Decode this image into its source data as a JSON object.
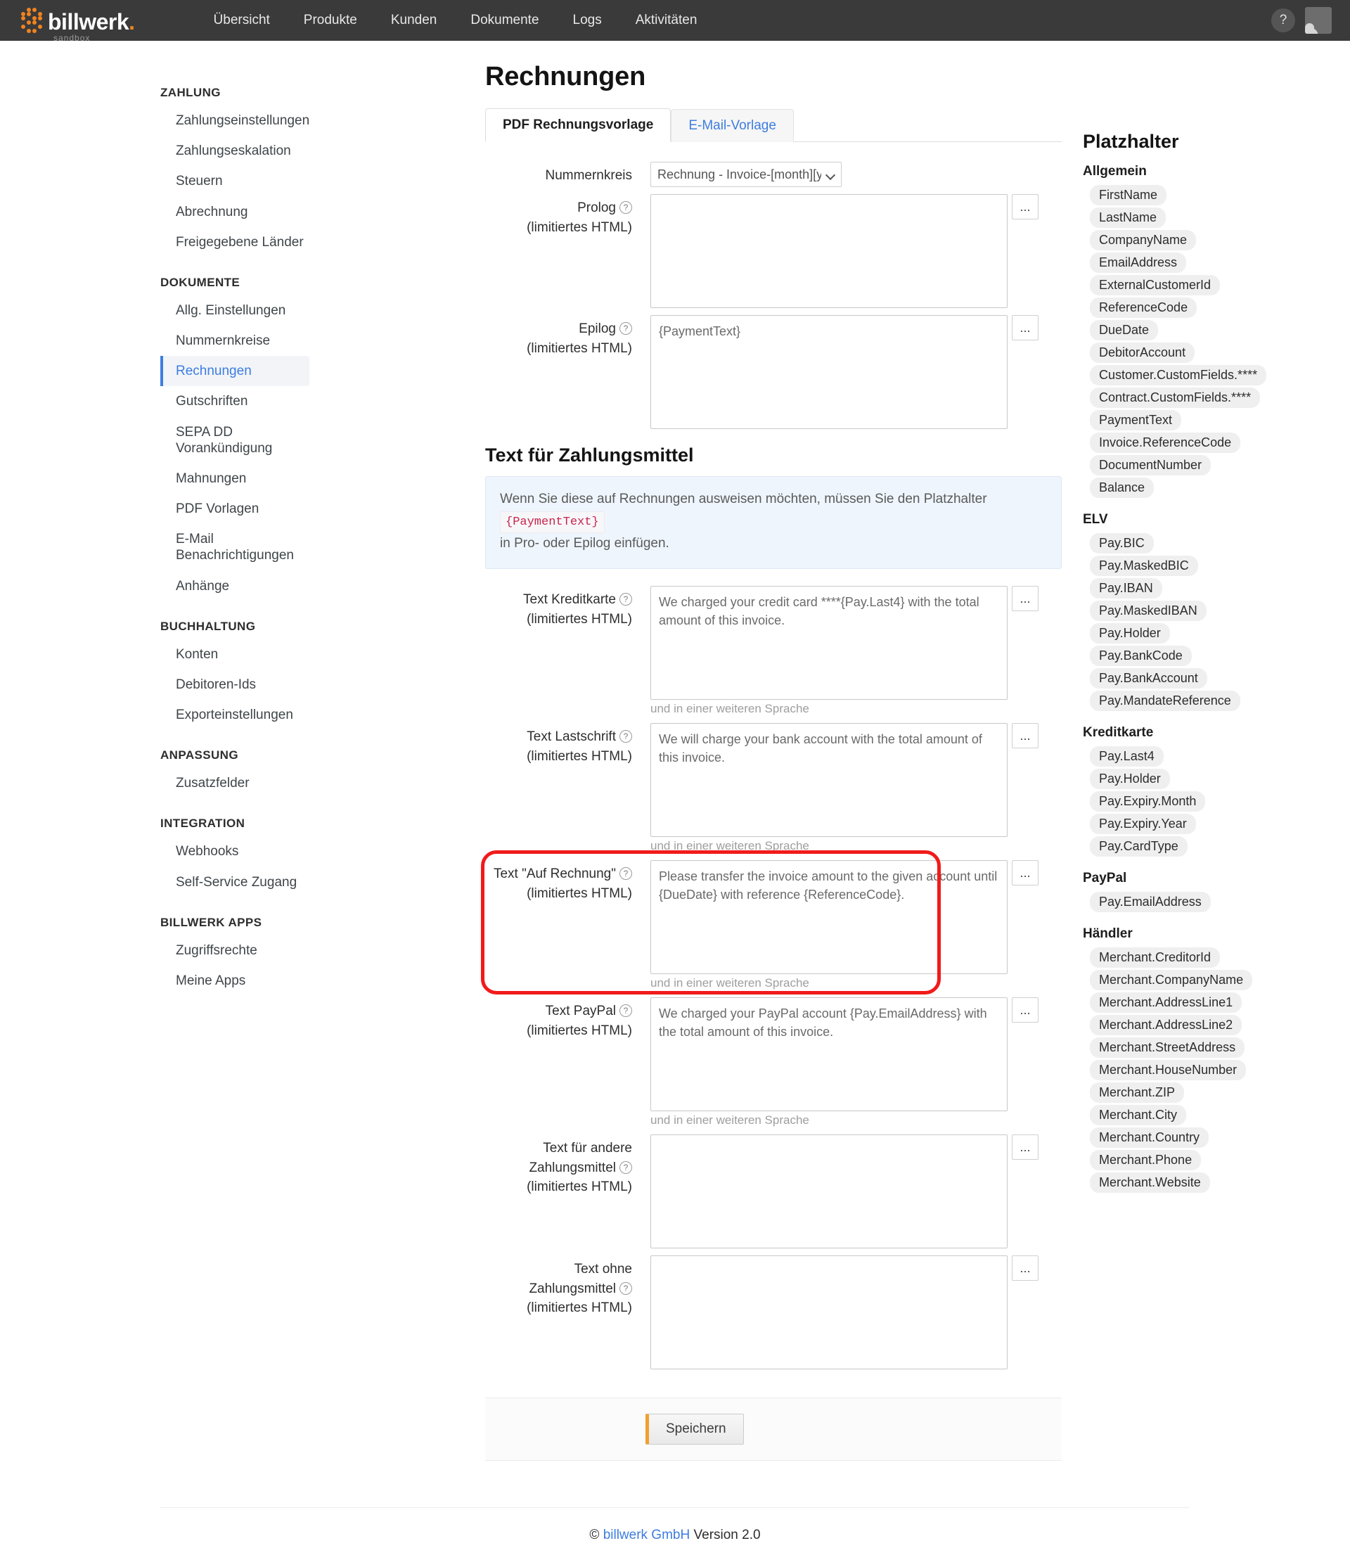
{
  "topnav": {
    "brand": {
      "name": "billwerk",
      "dot": ".",
      "sub": "sandbox"
    },
    "links": [
      "Übersicht",
      "Produkte",
      "Kunden",
      "Dokumente",
      "Logs",
      "Aktivitäten"
    ],
    "help_label": "?"
  },
  "sidebar": {
    "groups": [
      {
        "title": "ZAHLUNG",
        "items": [
          {
            "label": "Zahlungseinstellungen",
            "active": false
          },
          {
            "label": "Zahlungseskalation",
            "active": false
          },
          {
            "label": "Steuern",
            "active": false
          },
          {
            "label": "Abrechnung",
            "active": false
          },
          {
            "label": "Freigegebene Länder",
            "active": false
          }
        ]
      },
      {
        "title": "DOKUMENTE",
        "items": [
          {
            "label": "Allg. Einstellungen",
            "active": false
          },
          {
            "label": "Nummernkreise",
            "active": false
          },
          {
            "label": "Rechnungen",
            "active": true
          },
          {
            "label": "Gutschriften",
            "active": false
          },
          {
            "label": "SEPA DD Vorankündigung",
            "active": false
          },
          {
            "label": "Mahnungen",
            "active": false
          },
          {
            "label": "PDF Vorlagen",
            "active": false
          },
          {
            "label": "E-Mail Benachrichtigungen",
            "active": false
          },
          {
            "label": "Anhänge",
            "active": false
          }
        ]
      },
      {
        "title": "BUCHHALTUNG",
        "items": [
          {
            "label": "Konten",
            "active": false
          },
          {
            "label": "Debitoren-Ids",
            "active": false
          },
          {
            "label": "Exporteinstellungen",
            "active": false
          }
        ]
      },
      {
        "title": "ANPASSUNG",
        "items": [
          {
            "label": "Zusatzfelder",
            "active": false
          }
        ]
      },
      {
        "title": "INTEGRATION",
        "items": [
          {
            "label": "Webhooks",
            "active": false
          },
          {
            "label": "Self-Service Zugang",
            "active": false
          }
        ]
      },
      {
        "title": "BILLWERK APPS",
        "items": [
          {
            "label": "Zugriffsrechte",
            "active": false
          },
          {
            "label": "Meine Apps",
            "active": false
          }
        ]
      }
    ]
  },
  "main": {
    "page_title": "Rechnungen",
    "tabs": [
      {
        "label": "PDF Rechnungsvorlage",
        "active": true
      },
      {
        "label": "E-Mail-Vorlage",
        "active": false
      }
    ],
    "nummernkreis": {
      "label": "Nummernkreis",
      "value": "Rechnung - Invoice-[month][year]-",
      "options": [
        "Rechnung - Invoice-[month][year]-"
      ]
    },
    "limited_html_note": "(limitiertes HTML)",
    "more_button_label": "...",
    "lang_hint": "und in einer weiteren Sprache",
    "fields_top": [
      {
        "label": "Prolog",
        "value": "",
        "hint": false
      },
      {
        "label": "Epilog",
        "value": "{PaymentText}",
        "hint": false
      }
    ],
    "section": {
      "title": "Text für Zahlungsmittel",
      "notice_before": "Wenn Sie diese auf Rechnungen ausweisen möchten, müssen Sie den Platzhalter",
      "notice_code": "{PaymentText}",
      "notice_after": "in Pro- oder Epilog einfügen."
    },
    "payment_fields": [
      {
        "label": "Text Kreditkarte",
        "value": "We charged your credit card ****{Pay.Last4} with the total amount of this invoice.",
        "hint": true,
        "highlighted": false
      },
      {
        "label": "Text Lastschrift",
        "value": "We will charge your bank account with the total amount of this invoice.",
        "hint": true,
        "highlighted": false
      },
      {
        "label": "Text \"Auf Rechnung\"",
        "value": "Please transfer the invoice amount to the given account until {DueDate} with reference {ReferenceCode}.",
        "hint": true,
        "highlighted": true
      },
      {
        "label": "Text PayPal",
        "value": "We charged your PayPal account {Pay.EmailAddress} with the total amount of this invoice.",
        "hint": true,
        "highlighted": false
      },
      {
        "label": "Text für andere Zahlungsmittel",
        "value": "",
        "hint": false,
        "highlighted": false
      },
      {
        "label": "Text ohne Zahlungsmittel",
        "value": "",
        "hint": false,
        "highlighted": false
      }
    ],
    "save_label": "Speichern"
  },
  "placeholders": {
    "title": "Platzhalter",
    "groups": [
      {
        "title": "Allgemein",
        "items": [
          "FirstName",
          "LastName",
          "CompanyName",
          "EmailAddress",
          "ExternalCustomerId",
          "ReferenceCode",
          "DueDate",
          "DebitorAccount",
          "Customer.CustomFields.****",
          "Contract.CustomFields.****",
          "PaymentText",
          "Invoice.ReferenceCode",
          "DocumentNumber",
          "Balance"
        ]
      },
      {
        "title": "ELV",
        "items": [
          "Pay.BIC",
          "Pay.MaskedBIC",
          "Pay.IBAN",
          "Pay.MaskedIBAN",
          "Pay.Holder",
          "Pay.BankCode",
          "Pay.BankAccount",
          "Pay.MandateReference"
        ]
      },
      {
        "title": "Kreditkarte",
        "items": [
          "Pay.Last4",
          "Pay.Holder",
          "Pay.Expiry.Month",
          "Pay.Expiry.Year",
          "Pay.CardType"
        ]
      },
      {
        "title": "PayPal",
        "items": [
          "Pay.EmailAddress"
        ]
      },
      {
        "title": "Händler",
        "items": [
          "Merchant.CreditorId",
          "Merchant.CompanyName",
          "Merchant.AddressLine1",
          "Merchant.AddressLine2",
          "Merchant.StreetAddress",
          "Merchant.HouseNumber",
          "Merchant.ZIP",
          "Merchant.City",
          "Merchant.Country",
          "Merchant.Phone",
          "Merchant.Website"
        ]
      }
    ]
  },
  "footer": {
    "copyright": "©",
    "link": "billwerk GmbH",
    "version": "Version 2.0"
  },
  "colors": {
    "brand_orange": "#f0831e",
    "accent_blue": "#3d7ddf",
    "annotation_red": "#f11b1b",
    "code_pink": "#c7254e"
  }
}
